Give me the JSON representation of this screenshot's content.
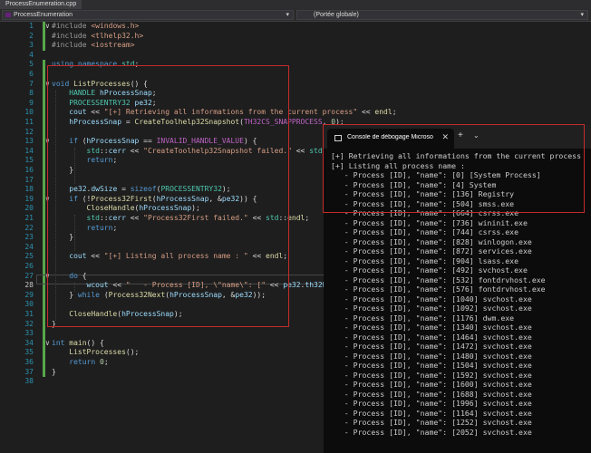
{
  "tab": {
    "title": "ProcessEnumeration.cpp"
  },
  "nav": {
    "project": "ProcessEnumeration",
    "scope": "(Portée globale)"
  },
  "code_lines": [
    {
      "n": "1",
      "html": "<span class=\"pp\">#include</span> <span class=\"inc\">&lt;windows.h&gt;</span>"
    },
    {
      "n": "2",
      "html": "<span class=\"pp\">#include</span> <span class=\"inc\">&lt;tlhelp32.h&gt;</span>"
    },
    {
      "n": "3",
      "html": "<span class=\"pp\">#include</span> <span class=\"inc\">&lt;iostream&gt;</span>"
    },
    {
      "n": "4",
      "html": ""
    },
    {
      "n": "5",
      "html": "<span class=\"kw\">using namespace</span> <span class=\"ty\">std</span>;"
    },
    {
      "n": "6",
      "html": ""
    },
    {
      "n": "7",
      "html": "<span class=\"kw\">void</span> <span class=\"fn\">ListProcesses</span>() {"
    },
    {
      "n": "8",
      "html": "    <span class=\"ty\">HANDLE</span> <span class=\"vr\">hProcessSnap</span>;"
    },
    {
      "n": "9",
      "html": "    <span class=\"ty\">PROCESSENTRY32</span> <span class=\"vr\">pe32</span>;"
    },
    {
      "n": "10",
      "html": "    <span class=\"vr\">cout</span> &lt;&lt; <span class=\"st\">\"[+] Retrieving all informations from the current process\"</span> &lt;&lt; <span class=\"fn\">endl</span>;"
    },
    {
      "n": "11",
      "html": "    <span class=\"vr\">hProcessSnap</span> = <span class=\"fn\">CreateToolhelp32Snapshot</span>(<span class=\"mac\">TH32CS_SNAPPROCESS</span>, <span class=\"nm\">0</span>);"
    },
    {
      "n": "12",
      "html": ""
    },
    {
      "n": "13",
      "html": "    <span class=\"kw\">if</span> (<span class=\"vr\">hProcessSnap</span> == <span class=\"mac\">INVALID_HANDLE_VALUE</span>) {"
    },
    {
      "n": "14",
      "html": "        <span class=\"ty\">std</span>::<span class=\"vr\">cerr</span> &lt;&lt; <span class=\"st\">\"CreateToolhelp32Snapshot failed.\"</span> &lt;&lt; <span class=\"ty\">std</span>::endl;"
    },
    {
      "n": "15",
      "html": "        <span class=\"kw\">return</span>;"
    },
    {
      "n": "16",
      "html": "    }"
    },
    {
      "n": "17",
      "html": ""
    },
    {
      "n": "18",
      "html": "    <span class=\"vr\">pe32</span>.<span class=\"vr\">dwSize</span> = <span class=\"kw\">sizeof</span>(<span class=\"ty\">PROCESSENTRY32</span>);"
    },
    {
      "n": "19",
      "html": "    <span class=\"kw\">if</span> (!<span class=\"fn\">Process32First</span>(<span class=\"vr\">hProcessSnap</span>, &amp;<span class=\"vr\">pe32</span>)) {"
    },
    {
      "n": "20",
      "html": "        <span class=\"fn\">CloseHandle</span>(<span class=\"vr\">hProcessSnap</span>);"
    },
    {
      "n": "21",
      "html": "        <span class=\"ty\">std</span>::<span class=\"vr\">cerr</span> &lt;&lt; <span class=\"st\">\"Process32First failed.\"</span> &lt;&lt; <span class=\"ty\">std</span>::<span class=\"fn\">endl</span>;"
    },
    {
      "n": "22",
      "html": "        <span class=\"kw\">return</span>;"
    },
    {
      "n": "23",
      "html": "    }"
    },
    {
      "n": "24",
      "html": ""
    },
    {
      "n": "25",
      "html": "    <span class=\"vr\">cout</span> &lt;&lt; <span class=\"st\">\"[+] Listing all process name : \"</span> &lt;&lt; <span class=\"fn\">endl</span>;"
    },
    {
      "n": "26",
      "html": ""
    },
    {
      "n": "27",
      "html": "    <span class=\"kw\">do</span> {"
    },
    {
      "n": "28",
      "html": "        <span class=\"vr\">wcout</span> &lt;&lt; <span class=\"st\">\"   - Process [ID], \\\"name\\\": [\"</span> &lt;&lt; <span class=\"vr\">pe32</span>.<span class=\"vr\">th32ProcessID</span>"
    },
    {
      "n": "29",
      "html": "    } <span class=\"kw\">while</span> (<span class=\"fn\">Process32Next</span>(<span class=\"vr\">hProcessSnap</span>, &amp;<span class=\"vr\">pe32</span>));"
    },
    {
      "n": "30",
      "html": ""
    },
    {
      "n": "31",
      "html": "    <span class=\"fn\">CloseHandle</span>(<span class=\"vr\">hProcessSnap</span>);"
    },
    {
      "n": "32",
      "html": "}"
    },
    {
      "n": "33",
      "html": ""
    },
    {
      "n": "34",
      "html": "<span class=\"kw\">int</span> <span class=\"fn\">main</span>() {"
    },
    {
      "n": "35",
      "html": "    <span class=\"fn\">ListProcesses</span>();"
    },
    {
      "n": "36",
      "html": "    <span class=\"kw\">return</span> <span class=\"nm\">0</span>;"
    },
    {
      "n": "37",
      "html": "}"
    },
    {
      "n": "38",
      "html": ""
    }
  ],
  "console": {
    "title": "Console de débogage Microso",
    "plus": "+",
    "lines": [
      "[+] Retrieving all informations from the current process",
      "[+] Listing all process name :",
      "   - Process [ID], \"name\": [0] [System Process]",
      "   - Process [ID], \"name\": [4] System",
      "   - Process [ID], \"name\": [136] Registry",
      "   - Process [ID], \"name\": [504] smss.exe",
      "   - Process [ID], \"name\": [664] csrss.exe",
      "   - Process [ID], \"name\": [736] wininit.exe",
      "   - Process [ID], \"name\": [744] csrss.exe",
      "   - Process [ID], \"name\": [828] winlogon.exe",
      "   - Process [ID], \"name\": [872] services.exe",
      "   - Process [ID], \"name\": [904] lsass.exe",
      "   - Process [ID], \"name\": [492] svchost.exe",
      "   - Process [ID], \"name\": [532] fontdrvhost.exe",
      "   - Process [ID], \"name\": [576] fontdrvhost.exe",
      "   - Process [ID], \"name\": [1040] svchost.exe",
      "   - Process [ID], \"name\": [1092] svchost.exe",
      "   - Process [ID], \"name\": [1176] dwm.exe",
      "   - Process [ID], \"name\": [1340] svchost.exe",
      "   - Process [ID], \"name\": [1464] svchost.exe",
      "   - Process [ID], \"name\": [1472] svchost.exe",
      "   - Process [ID], \"name\": [1480] svchost.exe",
      "   - Process [ID], \"name\": [1504] svchost.exe",
      "   - Process [ID], \"name\": [1592] svchost.exe",
      "   - Process [ID], \"name\": [1600] svchost.exe",
      "   - Process [ID], \"name\": [1688] svchost.exe",
      "   - Process [ID], \"name\": [1996] svchost.exe",
      "   - Process [ID], \"name\": [1164] svchost.exe",
      "   - Process [ID], \"name\": [1252] svchost.exe",
      "   - Process [ID], \"name\": [2052] svchost.exe"
    ]
  },
  "current_line": "28"
}
